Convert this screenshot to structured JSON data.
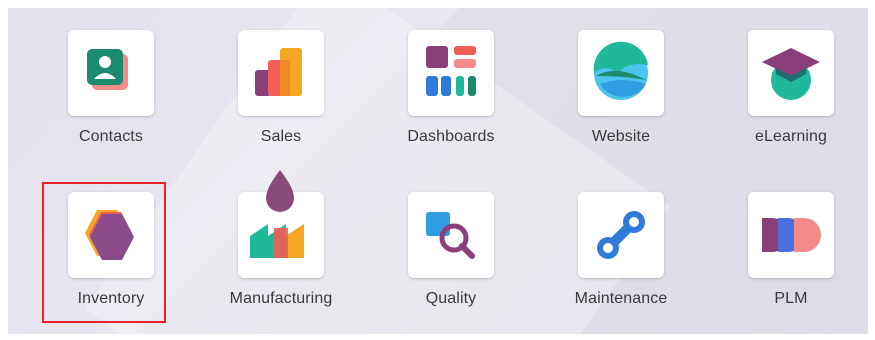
{
  "apps": [
    {
      "label": "Contacts",
      "icon": "contacts-icon"
    },
    {
      "label": "Sales",
      "icon": "sales-icon"
    },
    {
      "label": "Dashboards",
      "icon": "dashboards-icon"
    },
    {
      "label": "Website",
      "icon": "website-icon"
    },
    {
      "label": "eLearning",
      "icon": "elearning-icon"
    },
    {
      "label": "Inventory",
      "icon": "inventory-icon",
      "highlighted": true
    },
    {
      "label": "Manufacturing",
      "icon": "manufacturing-icon"
    },
    {
      "label": "Quality",
      "icon": "quality-icon"
    },
    {
      "label": "Maintenance",
      "icon": "maintenance-icon"
    },
    {
      "label": "PLM",
      "icon": "plm-icon"
    }
  ],
  "colors": {
    "highlight": "#e8202a",
    "teal": "#1fb89a",
    "purple": "#8a4b8a",
    "orange": "#f08a2c",
    "red": "#f25d55",
    "blue": "#2f7bd9"
  }
}
